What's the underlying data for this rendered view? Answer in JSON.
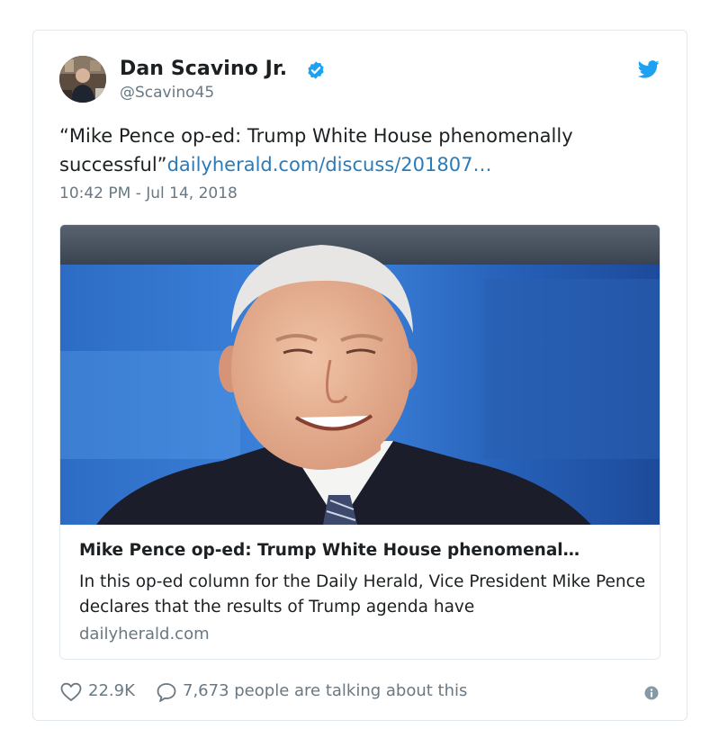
{
  "author": {
    "display_name": "Dan Scavino Jr.",
    "handle": "@Scavino45",
    "verified": true
  },
  "tweet": {
    "text_prefix": "“Mike Pence op-ed: Trump White House phenomenally successful”",
    "link_text": "dailyherald.com/discuss/201807…",
    "timestamp": "10:42 PM - Jul 14, 2018"
  },
  "card": {
    "title": "Mike Pence op-ed: Trump White House phenomenal…",
    "description": "In this op-ed column for the Daily Herald, Vice President Mike Pence declares that the results of Trump agenda have",
    "domain": "dailyherald.com"
  },
  "actions": {
    "likes": "22.9K",
    "talking": "7,673 people are talking about this"
  },
  "icons": {
    "verified": "verified-badge-icon",
    "brand": "twitter-bird-icon",
    "like": "heart-icon",
    "reply": "speech-bubble-icon",
    "info": "info-icon"
  },
  "colors": {
    "link": "#2b7bb9",
    "secondary_text": "#697882",
    "twitter_blue": "#1da1f2",
    "border": "#e1e8ed"
  }
}
